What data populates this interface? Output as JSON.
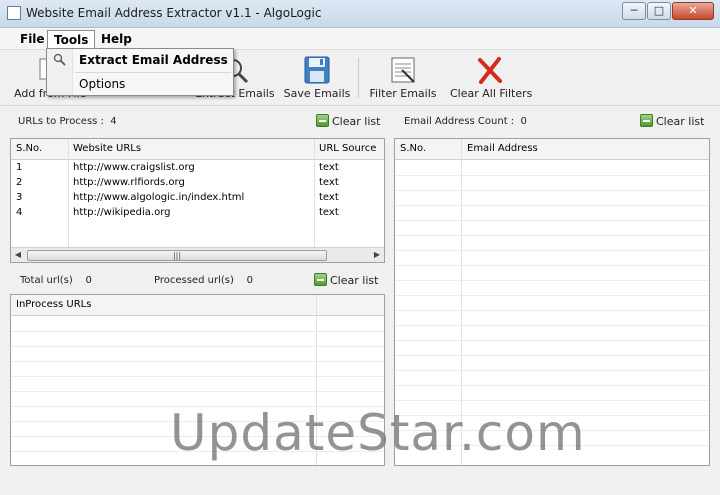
{
  "window": {
    "title": "Website Email Address Extractor v1.1 - AlgoLogic",
    "buttons": {
      "minimize": "─",
      "maximize": "□",
      "close": "✕"
    }
  },
  "menu": {
    "file": "File",
    "tools": "Tools",
    "help": "Help"
  },
  "tools_menu": {
    "items": [
      "Extract Email Address",
      "Options"
    ]
  },
  "toolbar": {
    "add_partial": "Add f",
    "add_partial2": "rom File",
    "extract_partial": "Extract Emails",
    "save": "Save Emails",
    "filter": "Filter Emails",
    "clear_filters": "Clear All Filters"
  },
  "urls_panel": {
    "label": "URLs to Process :",
    "count": "4",
    "clear": "Clear list",
    "columns": [
      "S.No.",
      "Website URLs",
      "URL Source"
    ],
    "rows": [
      [
        "1",
        "http://www.craigslist.org",
        "text"
      ],
      [
        "2",
        "http://www.rlfiords.org",
        "text"
      ],
      [
        "3",
        "http://www.algologic.in/index.html",
        "text"
      ],
      [
        "4",
        "http://wikipedia.org",
        "text"
      ]
    ],
    "scroll_grip": "|||"
  },
  "progress_panel": {
    "total_label": "Total url(s)",
    "total_value": "0",
    "processed_label": "Processed url(s)",
    "processed_value": "0",
    "clear": "Clear list",
    "column": "InProcess URLs"
  },
  "email_panel": {
    "label": "Email Address Count :",
    "count": "0",
    "clear": "Clear list",
    "columns": [
      "S.No.",
      "Email Address"
    ]
  },
  "watermark": "UpdateStar.com",
  "colors": {
    "accent": "#2b579a",
    "delete_red": "#d42b1e",
    "clear_green": "#4d9b2f"
  }
}
